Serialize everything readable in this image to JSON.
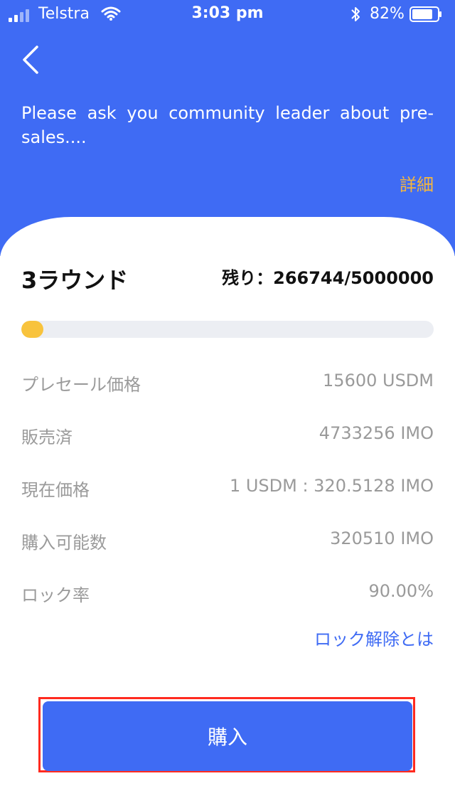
{
  "status_bar": {
    "carrier": "Telstra",
    "time": "3:03 pm",
    "battery": "82%",
    "battery_level": 0.82,
    "icons": [
      "signal-icon",
      "wifi-icon",
      "bluetooth-icon",
      "battery-icon"
    ]
  },
  "header": {
    "back_icon": "chevron-left-icon",
    "notice": "Please ask you community leader about pre-sales....",
    "details_label": "詳細"
  },
  "round": {
    "title": "3ラウンド",
    "remaining": "残り：266744/5000000",
    "progress_fraction": 0.053
  },
  "info": [
    {
      "label": "プレセール価格",
      "value": "15600 USDM"
    },
    {
      "label": "販売済",
      "value": "4733256 IMO"
    },
    {
      "label": "現在価格",
      "value": "1 USDM : 320.5128 IMO"
    },
    {
      "label": "購入可能数",
      "value": "320510 IMO"
    },
    {
      "label": "ロック率",
      "value": "90.00%"
    }
  ],
  "unlock_link": "ロック解除とは",
  "buy_label": "購入",
  "colors": {
    "primary": "#3f6bf4",
    "accent_yellow": "#f8c33d",
    "details_orange": "#f6b73c",
    "highlight_red": "#ff2a1f"
  }
}
